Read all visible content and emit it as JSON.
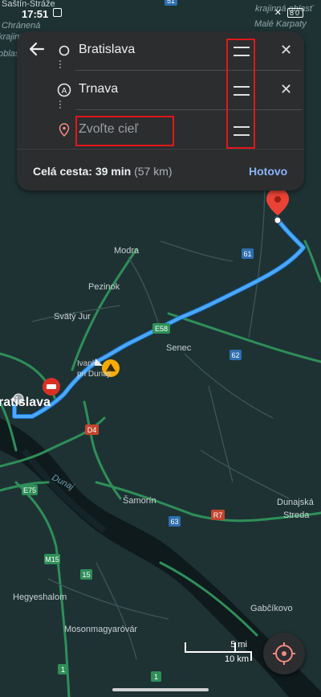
{
  "status_bar": {
    "time": "17:51",
    "battery": "80"
  },
  "route_card": {
    "origin": "Bratislava",
    "waypoint": "Trnava",
    "destination_placeholder": "Zvoľte cieľ",
    "waypoint_marker": "A",
    "summary_label": "Celá cesta:",
    "summary_time": "39 min",
    "summary_distance": "(57 km)",
    "done_label": "Hotovo"
  },
  "map": {
    "place_labels": {
      "sastin": "Šaštín-Stráže",
      "chranena": "Chránená",
      "krajinna_top": "krajinná oblasť",
      "krajinna_left": "krajinná",
      "oblast_left": "oblasť",
      "male_karpaty": "Malé Karpaty",
      "modra": "Modra",
      "pezinok": "Pezinok",
      "svaty_jur": "Svätý Jur",
      "senec": "Senec",
      "ivanka_a": "Ivanka",
      "ivanka_b": "pri Dunaji",
      "bratislava": "ratislava",
      "dunaj": "Dunaj",
      "samorin": "Šamorín",
      "dunajska_a": "Dunajská",
      "dunajska_b": "Streda",
      "hegyeshalom": "Hegyeshalom",
      "mosonmagyarovar": "Mosonmagyaróvár",
      "gabcikovo": "Gabčíkovo"
    },
    "road_shields": {
      "r51": "51",
      "r61": "61",
      "e58": "E58",
      "r62": "62",
      "d4": "D4",
      "e75": "E75",
      "r63": "63",
      "r7": "R7",
      "m15": "M15",
      "r15": "15",
      "r1": "1"
    },
    "scale_mi": "5 mi",
    "scale_km": "10 km"
  },
  "colors": {
    "route": "#4aa9ff",
    "road_green": "#2e8f58",
    "water": "#0f1a1d",
    "card": "#2b2d2f",
    "accent_blue": "#8ab4f8",
    "annotation_red": "#e0181b",
    "pin_red": "#ea4335"
  },
  "icons": {
    "back": "arrow-left-icon",
    "origin": "circle-outline-icon",
    "waypoint": "waypoint-a-icon",
    "destination": "location-pin-icon",
    "remove": "close-icon",
    "reorder": "drag-handle-icon",
    "recenter": "compass-icon"
  }
}
